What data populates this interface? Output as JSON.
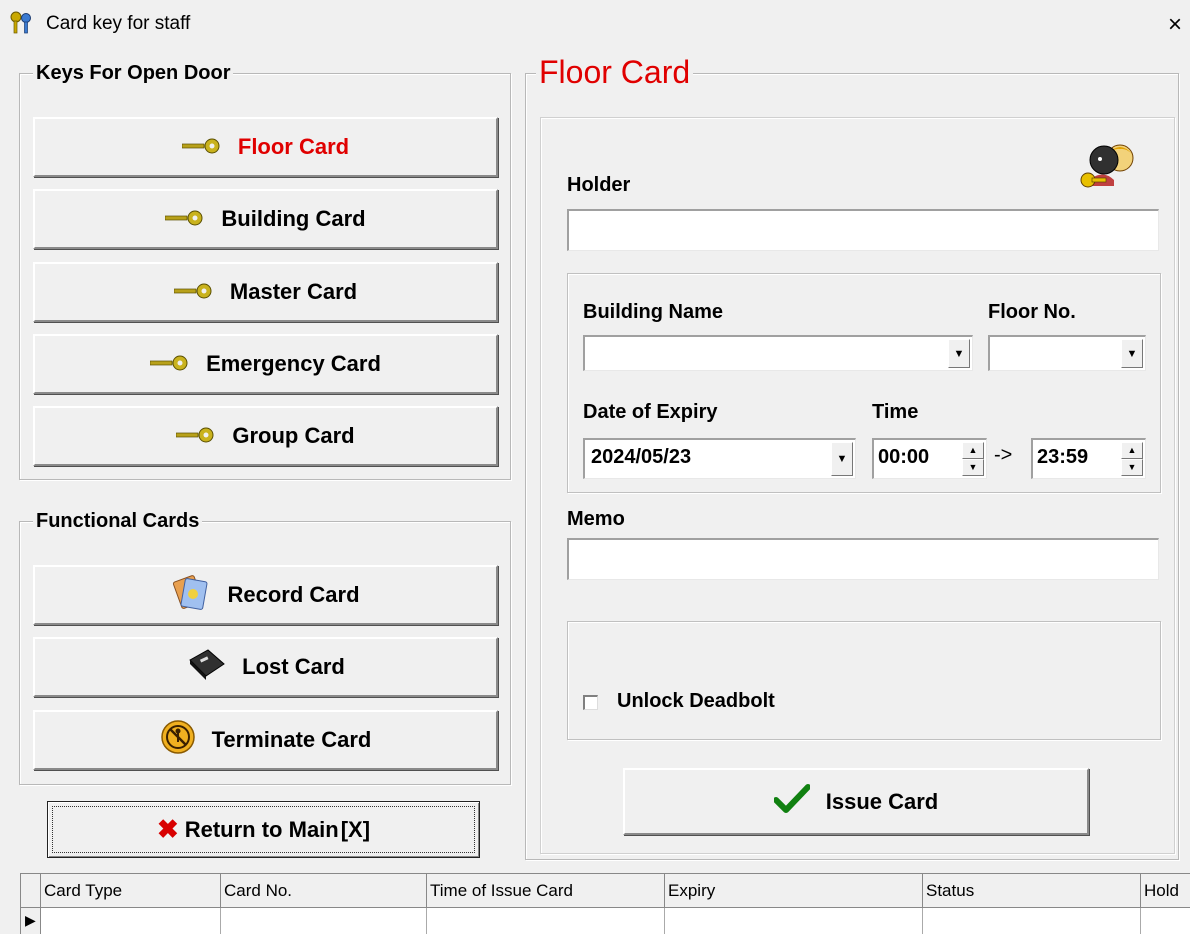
{
  "window": {
    "title": "Card key for staff",
    "close_glyph": "×",
    "icon": "keys-icon"
  },
  "keys_group": {
    "legend": "Keys For Open Door",
    "buttons": [
      {
        "label": "Floor Card",
        "icon": "key-icon",
        "active": true,
        "active_color": "#e00000"
      },
      {
        "label": "Building Card",
        "icon": "key-icon"
      },
      {
        "label": "Master Card",
        "icon": "key-icon"
      },
      {
        "label": "Emergency Card",
        "icon": "key-icon"
      },
      {
        "label": "Group Card",
        "icon": "key-icon"
      }
    ]
  },
  "functional_group": {
    "legend": "Functional Cards",
    "buttons": [
      {
        "label": "Record Card",
        "icon": "record-card-icon"
      },
      {
        "label": "Lost Card",
        "icon": "lost-card-icon"
      },
      {
        "label": "Terminate Card",
        "icon": "terminate-icon"
      }
    ]
  },
  "return_button": {
    "label": "Return to Main",
    "hotkey": "[X]",
    "icon": "red-x-icon"
  },
  "form": {
    "legend": "Floor Card",
    "legend_color": "#e00000",
    "holder_label": "Holder",
    "holder_value": "",
    "building_label": "Building Name",
    "building_value": "",
    "floor_label": "Floor No.",
    "floor_value": "",
    "expiry_label": "Date of Expiry",
    "expiry_value": "2024/05/23",
    "time_label": "Time",
    "time_from": "00:00",
    "time_arrow": "->",
    "time_to": "23:59",
    "memo_label": "Memo",
    "memo_value": "",
    "deadbolt_label": "Unlock Deadbolt",
    "deadbolt_checked": false,
    "issue_label": "Issue Card"
  },
  "grid": {
    "columns": [
      "Card Type",
      "Card No.",
      "Time of Issue Card",
      "Expiry",
      "Status",
      "Hold"
    ],
    "current_row_marker": "▶"
  }
}
